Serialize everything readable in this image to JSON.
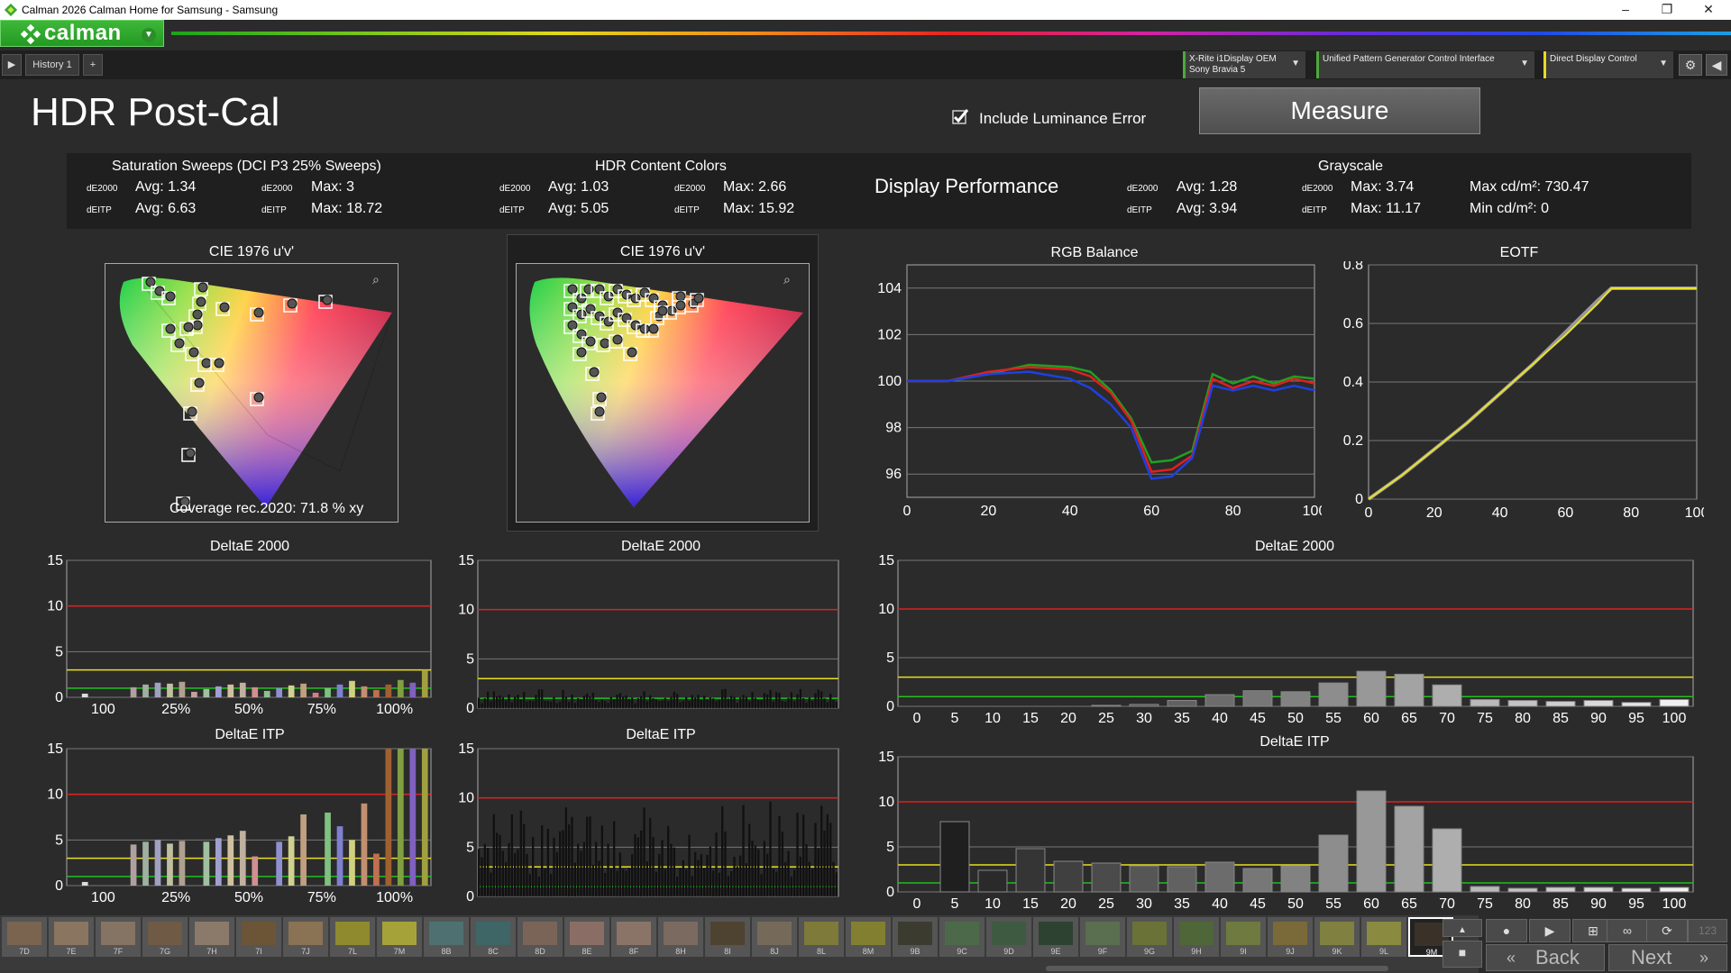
{
  "window": {
    "title": "Calman 2026 Calman Home for Samsung  - Samsung",
    "minimize": "–",
    "maximize": "❐",
    "close": "✕"
  },
  "logo": {
    "text": "calman"
  },
  "tabs": {
    "history": "History 1",
    "add": "+"
  },
  "devices": [
    {
      "line1": "X-Rite i1Display OEM",
      "line2": "Sony Bravia 5"
    },
    {
      "line1": "Unified Pattern Generator Control Interface",
      "line2": ""
    },
    {
      "line1": "Direct Display Control",
      "line2": ""
    }
  ],
  "page": {
    "title": "HDR Post-Cal",
    "include_lum": "Include Luminance Error",
    "measure": "Measure"
  },
  "summary": {
    "sat": {
      "title": "Saturation Sweeps (DCI P3 25% Sweeps)",
      "de2000_avg": "Avg: 1.34",
      "de2000_max": "Max: 3",
      "deitp_avg": "Avg: 6.63",
      "deitp_max": "Max: 18.72"
    },
    "hdr": {
      "title": "HDR Content Colors",
      "de2000_avg": "Avg: 1.03",
      "de2000_max": "Max: 2.66",
      "deitp_avg": "Avg: 5.05",
      "deitp_max": "Max: 15.92"
    },
    "display_perf": "Display Performance",
    "gray": {
      "title": "Grayscale",
      "de2000_avg": "Avg: 1.28",
      "de2000_max": "Max: 3.74",
      "deitp_avg": "Avg: 3.94",
      "deitp_max": "Max: 11.17",
      "maxcd": "Max cd/m²:  730.47",
      "mincd": "Min cd/m²:  0"
    },
    "m_de2000": "dE2000",
    "m_deitp": "dEITP"
  },
  "cie": {
    "title1": "CIE 1976 u'v'",
    "title2": "CIE 1976 u'v'",
    "coverage": "Coverage rec.2020:  71.8 % xy"
  },
  "charts": {
    "rgb": {
      "title": "RGB Balance",
      "x": [
        0,
        10,
        20,
        30,
        40,
        45,
        50,
        55,
        60,
        65,
        70,
        75,
        80,
        85,
        90,
        95,
        100
      ],
      "red": [
        100,
        100,
        100.4,
        100.6,
        100.5,
        100.2,
        99.5,
        98.3,
        96.1,
        96.2,
        96.8,
        100.1,
        99.7,
        100.0,
        99.8,
        100.1,
        99.9
      ],
      "green": [
        100,
        100,
        100.3,
        100.7,
        100.6,
        100.4,
        99.6,
        98.4,
        96.5,
        96.6,
        97.0,
        100.3,
        99.9,
        100.2,
        99.9,
        100.2,
        100.1
      ],
      "blue": [
        100,
        100,
        100.3,
        100.4,
        100.1,
        99.7,
        99.0,
        98.0,
        95.8,
        95.9,
        96.7,
        99.8,
        99.6,
        99.8,
        99.6,
        99.8,
        99.6
      ],
      "ylim": [
        95,
        105
      ],
      "yticks": [
        "104",
        "102",
        "100",
        "98",
        "96"
      ],
      "xticks": [
        "0",
        "20",
        "40",
        "60",
        "80",
        "100"
      ]
    },
    "eotf": {
      "title": "EOTF",
      "target": [
        [
          0,
          0
        ],
        [
          10,
          0.08
        ],
        [
          20,
          0.17
        ],
        [
          30,
          0.26
        ],
        [
          40,
          0.36
        ],
        [
          50,
          0.46
        ],
        [
          60,
          0.57
        ],
        [
          70,
          0.68
        ],
        [
          74,
          0.72
        ],
        [
          100,
          0.72
        ]
      ],
      "measured": [
        [
          0,
          0
        ],
        [
          10,
          0.08
        ],
        [
          20,
          0.17
        ],
        [
          30,
          0.26
        ],
        [
          40,
          0.36
        ],
        [
          50,
          0.46
        ],
        [
          60,
          0.56
        ],
        [
          70,
          0.67
        ],
        [
          74,
          0.72
        ],
        [
          100,
          0.72
        ]
      ],
      "ylim": [
        0,
        0.8
      ],
      "yticks": [
        "0.8",
        "0.6",
        "0.4",
        "0.2",
        "0"
      ],
      "xticks": [
        "0",
        "20",
        "40",
        "60",
        "80",
        "100"
      ]
    },
    "sat_de2000": {
      "title": "DeltaE 2000",
      "values": [
        0,
        0.4,
        0,
        0,
        0,
        1.1,
        1.4,
        1.6,
        1.5,
        1.7,
        0.6,
        0.9,
        1.2,
        1.4,
        1.6,
        1.1,
        0.7,
        1.0,
        1.3,
        1.5,
        0.5,
        1.0,
        1.4,
        1.8,
        1.2,
        0.8,
        1.4,
        1.9,
        1.6,
        3.0
      ],
      "ylim": [
        0,
        15
      ],
      "yticks": [
        "15",
        "10",
        "5",
        "0"
      ],
      "xticks": [
        "100",
        "25%",
        "50%",
        "75%",
        "100%"
      ]
    },
    "sat_deitp": {
      "title": "DeltaE ITP",
      "values": [
        0,
        0.4,
        0,
        0,
        0,
        4.5,
        4.8,
        5.0,
        4.6,
        4.9,
        0,
        4.8,
        5.2,
        5.5,
        6.0,
        3.2,
        0,
        4.8,
        5.4,
        7.8,
        0,
        8.0,
        6.5,
        5.0,
        9.0,
        3.5,
        17.5,
        17.5,
        17.0,
        18.7
      ],
      "ylim": [
        0,
        15
      ],
      "yticks": [
        "15",
        "10",
        "5",
        "0"
      ],
      "xticks": [
        "100",
        "25%",
        "50%",
        "75%",
        "100%"
      ]
    },
    "hdr_de2000": {
      "title": "DeltaE 2000",
      "ylim": [
        0,
        15
      ],
      "yticks": [
        "15",
        "10",
        "5",
        "0"
      ]
    },
    "hdr_deitp": {
      "title": "DeltaE ITP",
      "ylim": [
        0,
        15
      ],
      "yticks": [
        "15",
        "10",
        "5",
        "0"
      ]
    },
    "gray_de2000": {
      "title": "DeltaE 2000",
      "categories": [
        "0",
        "5",
        "10",
        "15",
        "20",
        "25",
        "30",
        "35",
        "40",
        "45",
        "50",
        "55",
        "60",
        "65",
        "70",
        "75",
        "80",
        "85",
        "90",
        "95",
        "100"
      ],
      "values": [
        0,
        0,
        0,
        0,
        0,
        0.1,
        0.2,
        0.6,
        1.2,
        1.6,
        1.5,
        2.4,
        3.6,
        3.3,
        2.2,
        0.7,
        0.6,
        0.5,
        0.6,
        0.4,
        0.7
      ],
      "ylim": [
        0,
        15
      ],
      "yticks": [
        "15",
        "10",
        "5",
        "0"
      ]
    },
    "gray_deitp": {
      "title": "DeltaE ITP",
      "categories": [
        "0",
        "5",
        "10",
        "15",
        "20",
        "25",
        "30",
        "35",
        "40",
        "45",
        "50",
        "55",
        "60",
        "65",
        "70",
        "75",
        "80",
        "85",
        "90",
        "95",
        "100"
      ],
      "values": [
        0,
        7.8,
        2.4,
        4.8,
        3.4,
        3.2,
        2.9,
        2.8,
        3.3,
        2.6,
        2.9,
        6.3,
        11.2,
        9.5,
        7.0,
        0.6,
        0.4,
        0.5,
        0.5,
        0.4,
        0.5
      ],
      "ylim": [
        0,
        15
      ],
      "yticks": [
        "15",
        "10",
        "5",
        "0"
      ]
    }
  },
  "swatches": [
    "7D",
    "7E",
    "7F",
    "7G",
    "7H",
    "7I",
    "7J",
    "7L",
    "7M",
    "8B",
    "8C",
    "8D",
    "8E",
    "8F",
    "8H",
    "8I",
    "8J",
    "8L",
    "8M",
    "9B",
    "9C",
    "9D",
    "9E",
    "9F",
    "9G",
    "9H",
    "9I",
    "9J",
    "9K",
    "9L",
    "9M"
  ],
  "swatch_colors": [
    "#7a6450",
    "#8a7560",
    "#857363",
    "#6e5a45",
    "#8b7a6a",
    "#6b5536",
    "#8a7255",
    "#8f8a2e",
    "#a6a23a",
    "#4f7070",
    "#3e6666",
    "#7a6458",
    "#8a6e66",
    "#8a7468",
    "#7b6a60",
    "#4e4230",
    "#756a5a",
    "#7d7a3a",
    "#828030",
    "#3b3b30",
    "#4c6a4a",
    "#3e5a40",
    "#2e4232",
    "#5a6e50",
    "#6a7238",
    "#4e6638",
    "#6e7a40",
    "#7a6a3a",
    "#808040",
    "#8a8a40",
    "#3a3228"
  ],
  "controls": {
    "back": "Back",
    "next": "Next",
    "count": "123"
  }
}
